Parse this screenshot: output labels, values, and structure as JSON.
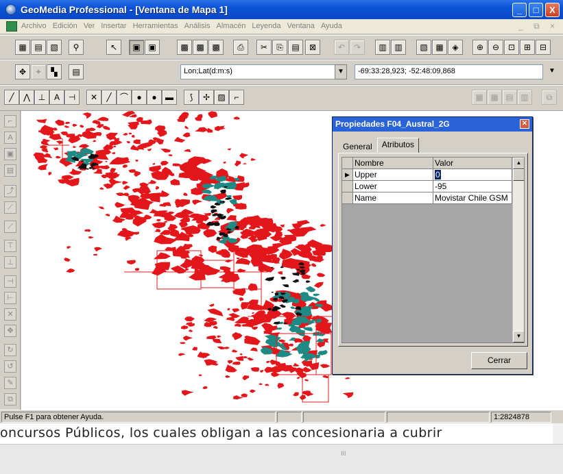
{
  "window": {
    "title": "GeoMedia Professional - [Ventana de Mapa 1]",
    "minimize": "_",
    "maximize": "□",
    "close": "X"
  },
  "menu": {
    "items": [
      "Archivo",
      "Edición",
      "Ver",
      "Insertar",
      "Herramientas",
      "Análisis",
      "Almacén",
      "Leyenda",
      "Ventana",
      "Ayuda"
    ],
    "mdi_controls": "_ ⧉ ×"
  },
  "toolbar2": {
    "coord_format": "Lon;Lat(d:m:s)",
    "coord_readout": "-69:33:28,923; -52:48:09,868"
  },
  "dialog": {
    "title": "Propiedades F04_Austral_2G",
    "tabs": [
      "General",
      "Atributos"
    ],
    "active_tab": "Atributos",
    "columns": [
      "Nombre",
      "Valor"
    ],
    "rows": [
      {
        "name": "Upper",
        "value": "0"
      },
      {
        "name": "Lower",
        "value": "-95"
      },
      {
        "name": "Name",
        "value": "Movistar Chile GSM"
      }
    ],
    "close_button": "Cerrar"
  },
  "status": {
    "help_text": "Pulse F1 para obtener Ayuda.",
    "scale": "1:2824878"
  },
  "document": {
    "text": "oncursos Públicos,  los cuales obligan a las concesionaria a cubrir",
    "grip": "III"
  },
  "colors": {
    "coverage_red": "#e3171b",
    "coverage_teal": "#1f8a84",
    "titlebar_blue": "#0a53d8"
  }
}
